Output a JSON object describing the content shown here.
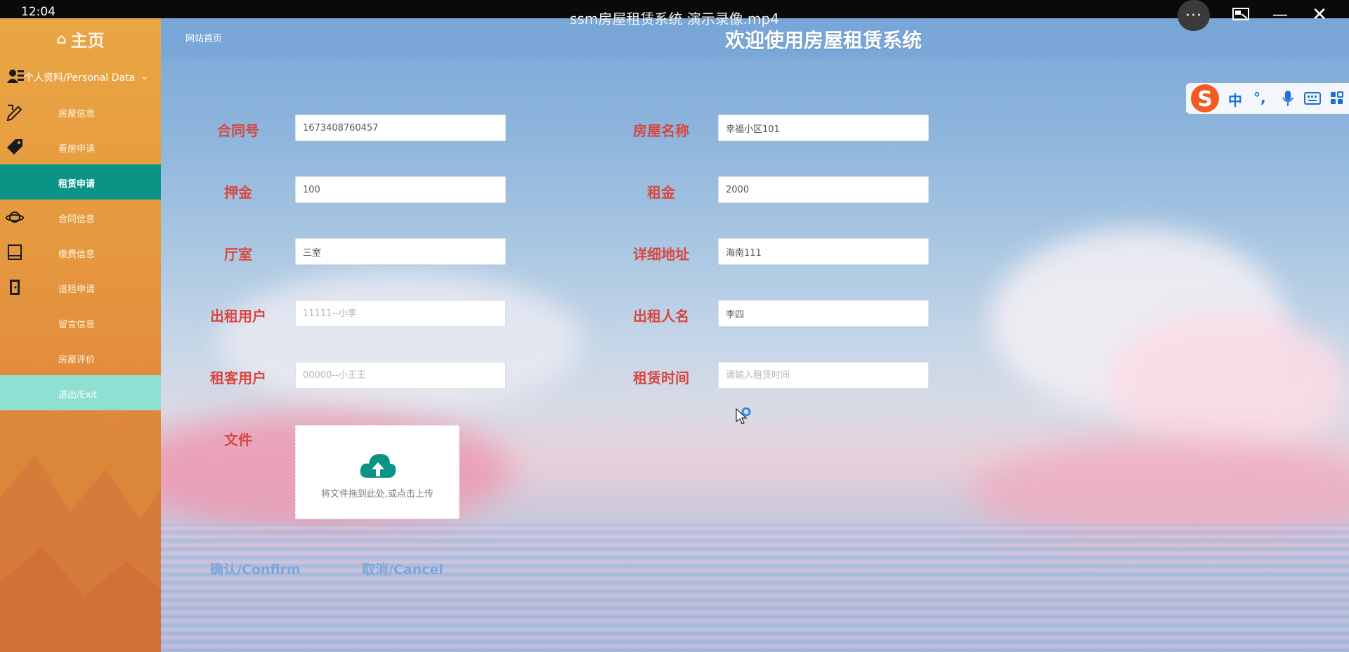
{
  "player": {
    "clock": "12:04",
    "title": "ssm房屋租赁系统 演示录像.mp4",
    "more_label": "···",
    "pip_icon": "picture-in-picture-icon",
    "min_label": "—",
    "close_label": "✕"
  },
  "sidebar": {
    "home_label": "主页",
    "section_label": "个人资料/Personal Data",
    "items": [
      {
        "label": "房屋信息",
        "icon": "pencil-ruler-icon"
      },
      {
        "label": "看房申请",
        "icon": "tag-icon"
      },
      {
        "label": "租赁申请",
        "icon": "",
        "active": true
      },
      {
        "label": "合同信息",
        "icon": "planet-icon"
      },
      {
        "label": "缴费信息",
        "icon": "book-icon"
      },
      {
        "label": "退租申请",
        "icon": "door-icon"
      },
      {
        "label": "留言信息",
        "icon": ""
      },
      {
        "label": "房屋评价",
        "icon": ""
      },
      {
        "label": "退出/Exit",
        "icon": ""
      }
    ]
  },
  "header": {
    "breadcrumb": "网站首页",
    "welcome": "欢迎使用房屋租赁系统"
  },
  "form": {
    "contract_no": {
      "label": "合同号",
      "value": "1673408760457"
    },
    "house_name": {
      "label": "房屋名称",
      "value": "幸福小区101"
    },
    "deposit": {
      "label": "押金",
      "value": "100"
    },
    "rent": {
      "label": "租金",
      "value": "2000"
    },
    "layout": {
      "label": "厅室",
      "value": "三室"
    },
    "address": {
      "label": "详细地址",
      "value": "海南111"
    },
    "landlord_user": {
      "label": "出租用户",
      "placeholder": "11111--小李"
    },
    "landlord_name": {
      "label": "出租人名",
      "value": "李四"
    },
    "tenant_user": {
      "label": "租客用户",
      "placeholder": "00000--小王王"
    },
    "rent_time": {
      "label": "租赁时间",
      "placeholder": "请输入租赁时间"
    },
    "file": {
      "label": "文件",
      "hint": "将文件拖到此处,或点击上传"
    },
    "confirm_label": "确认/Confirm",
    "cancel_label": "取消/Cancel"
  },
  "ime": {
    "logo": "S",
    "mode": "中",
    "punct": "°,",
    "voice_icon": "microphone-icon",
    "keyboard_icon": "keyboard-icon",
    "apps_icon": "apps-grid-icon"
  },
  "colors": {
    "sidebar_bg": "#e6993f",
    "sidebar_active": "#0a9485",
    "exit_bg": "#8fe0d2",
    "label_red": "#d9463f",
    "link_blue": "#7da7dc",
    "upload_icon": "#0a9485"
  }
}
